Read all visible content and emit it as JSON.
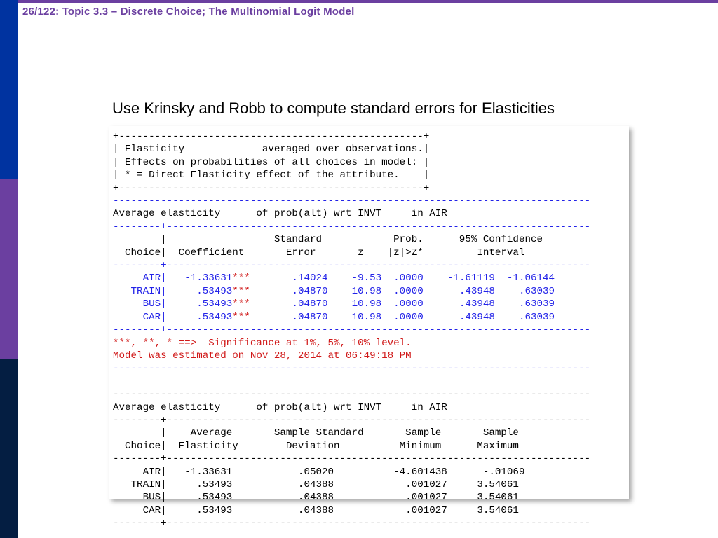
{
  "header": {
    "page_indicator": "26/122: Topic 3.3 – Discrete Choice; The Multinomial Logit Model"
  },
  "subtitle": "Use Krinsky and Robb to compute standard errors for Elasticities",
  "box": {
    "line1": "+---------------------------------------------------+",
    "line2": "| Elasticity             averaged over observations.|",
    "line3": "| Effects on probabilities of all choices in model: |",
    "line4": "| * = Direct Elasticity effect of the attribute.    |",
    "line5": "+---------------------------------------------------+"
  },
  "hr80": "--------------------------------------------------------------------------------",
  "sep": "--------+-----------------------------------------------------------------------",
  "sect1_title": "Average elasticity      of prob(alt) wrt INVT     in AIR",
  "hdr1a": "        |                  Standard            Prob.      95% Confidence",
  "hdr1b": "  Choice|  Coefficient       Error       z    |z|>Z*         Interval",
  "rows1": {
    "air": "     AIR|   -1.33631",
    "air_s": "***",
    "air_r": "       .14024    -9.53  .0000    -1.61119  -1.06144",
    "train": "   TRAIN|     .53493",
    "train_s": "***",
    "train_r": "       .04870    10.98  .0000      .43948    .63039",
    "bus": "     BUS|     .53493",
    "bus_s": "***",
    "bus_r": "       .04870    10.98  .0000      .43948    .63039",
    "car": "     CAR|     .53493",
    "car_s": "***",
    "car_r": "       .04870    10.98  .0000      .43948    .63039"
  },
  "sig_line": "***, **, * ==>  Significance at 1%, 5%, 10% level.",
  "model_line": "Model was estimated on Nov 28, 2014 at 06:49:18 PM",
  "sect2_title": "Average elasticity      of prob(alt) wrt INVT     in AIR",
  "hdr2a": "        |    Average       Sample Standard       Sample       Sample",
  "hdr2b": "  Choice|  Elasticity        Deviation          Minimum      Maximum",
  "rows2": {
    "air": "     AIR|   -1.33631           .05020          -4.601438      -.01069",
    "train": "   TRAIN|     .53493           .04388            .001027     3.54061",
    "bus": "     BUS|     .53493           .04388            .001027     3.54061",
    "car": "     CAR|     .53493           .04388            .001027     3.54061"
  }
}
